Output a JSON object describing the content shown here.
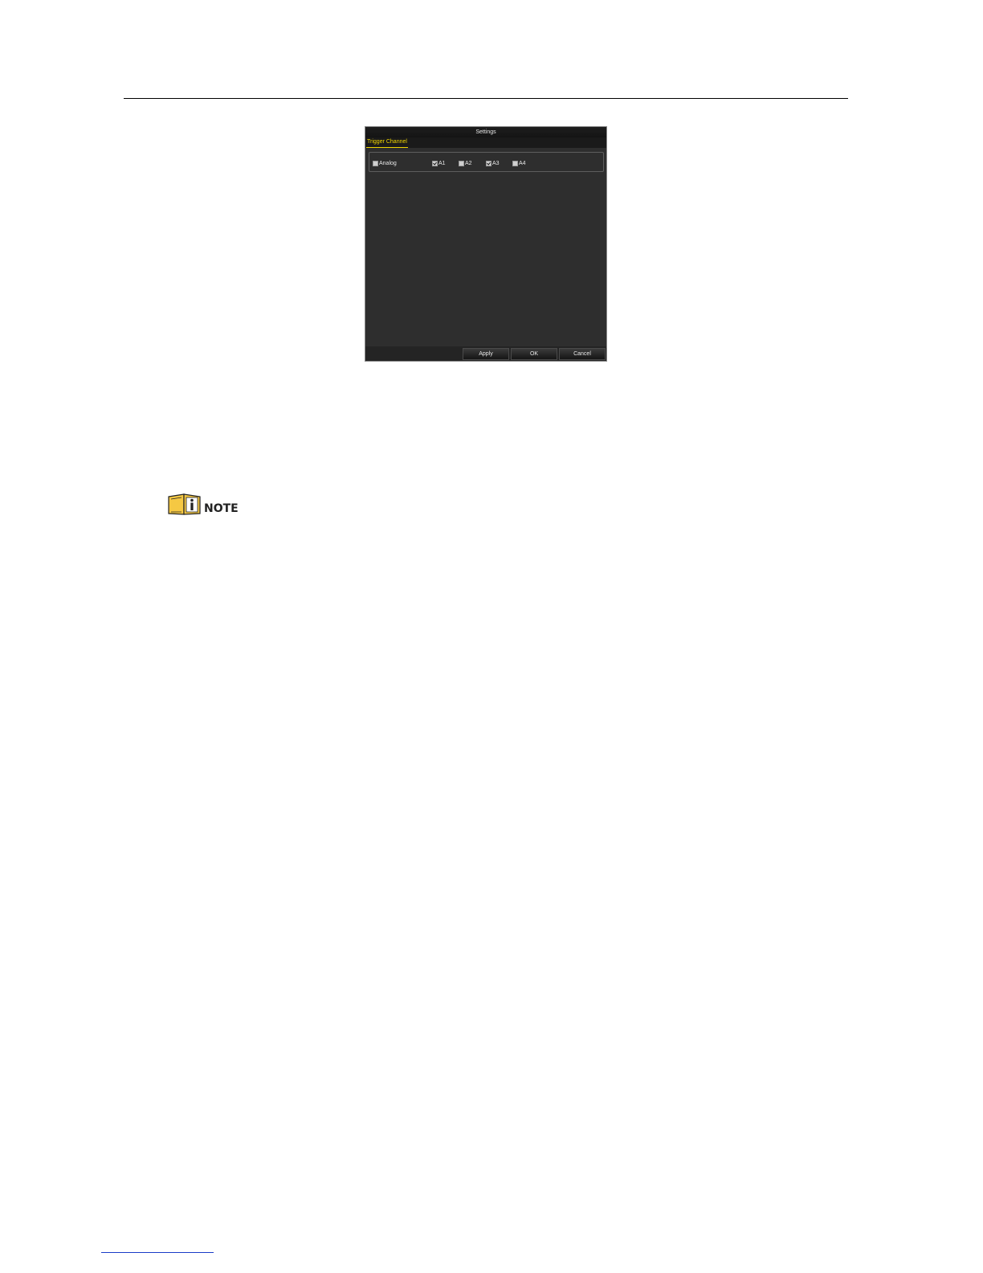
{
  "dialog": {
    "title": "Settings",
    "tab_label": "Trigger Channel",
    "group": {
      "master": {
        "label": "Analog",
        "checked": false
      },
      "channels": [
        {
          "label": "A1",
          "checked": true
        },
        {
          "label": "A2",
          "checked": false
        },
        {
          "label": "A3",
          "checked": true
        },
        {
          "label": "A4",
          "checked": false
        }
      ]
    },
    "buttons": {
      "apply": "Apply",
      "ok": "OK",
      "cancel": "Cancel"
    }
  },
  "note": {
    "label": "NOTE",
    "icon": "info-book-icon",
    "icon_color": "#f5c843"
  }
}
